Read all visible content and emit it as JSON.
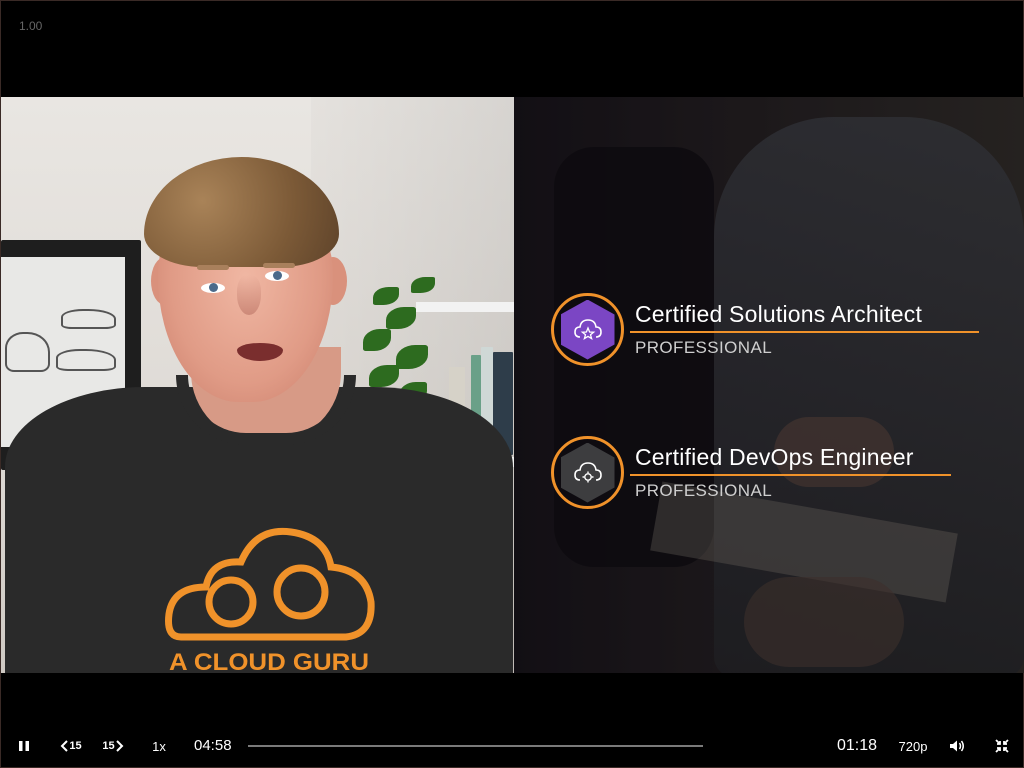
{
  "player": {
    "rate_readout": "1.00"
  },
  "video": {
    "shirt_text": "A CLOUD GURU",
    "certifications": [
      {
        "title": "Certified Solutions Architect",
        "level": "PROFESSIONAL",
        "badge_color": "#7b46c4",
        "icon": "cloud-star-icon"
      },
      {
        "title": "Certified DevOps Engineer",
        "level": "PROFESSIONAL",
        "badge_color": "#3d3d3f",
        "icon": "cloud-gear-icon"
      }
    ],
    "accent_color": "#f0922a"
  },
  "controls": {
    "pause_icon": "pause-icon",
    "skip_back_label": "15",
    "skip_forward_label": "15",
    "playback_rate": "1x",
    "time_elapsed": "04:58",
    "time_remaining": "01:18",
    "progress": 0.0,
    "quality": "720p",
    "volume_icon": "volume-icon",
    "exit_fullscreen_icon": "exit-fullscreen-icon"
  }
}
